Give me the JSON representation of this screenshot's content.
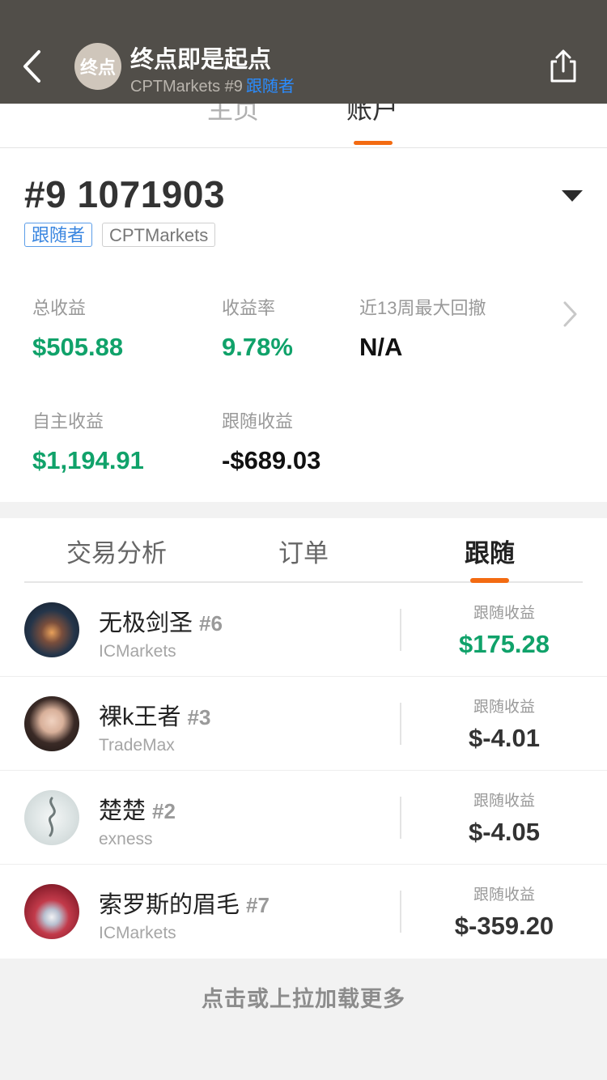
{
  "header": {
    "avatar_text": "终点",
    "title": "终点即是起点",
    "subtitle": "CPTMarkets #9",
    "role": "跟随者"
  },
  "top_tabs": [
    "主页",
    "账户"
  ],
  "account": {
    "title": "#9 1071903",
    "badges": [
      "跟随者",
      "CPTMarkets"
    ],
    "stats": {
      "total_profit_label": "总收益",
      "total_profit": "$505.88",
      "return_rate_label": "收益率",
      "return_rate": "9.78%",
      "max_drawdown_label": "近13周最大回撤",
      "max_drawdown": "N/A",
      "self_profit_label": "自主收益",
      "self_profit": "$1,194.91",
      "follow_profit_label": "跟随收益",
      "follow_profit": "-$689.03"
    }
  },
  "section_tabs": [
    "交易分析",
    "订单",
    "跟随"
  ],
  "followings": [
    {
      "name": "无极剑圣",
      "rank": "#6",
      "broker": "ICMarkets",
      "pl_label": "跟随收益",
      "pl": "$175.28"
    },
    {
      "name": "裸k王者",
      "rank": "#3",
      "broker": "TradeMax",
      "pl_label": "跟随收益",
      "pl": "$-4.01"
    },
    {
      "name": "楚楚",
      "rank": "#2",
      "broker": "exness",
      "pl_label": "跟随收益",
      "pl": "$-4.05"
    },
    {
      "name": "索罗斯的眉毛",
      "rank": "#7",
      "broker": "ICMarkets",
      "pl_label": "跟随收益",
      "pl": "$-359.20"
    }
  ],
  "load_more": "点击或上拉加载更多",
  "colors": {
    "accent": "#f36b12",
    "positive": "#10a26a",
    "link": "#2a8cff",
    "header_bg": "#514e49"
  }
}
